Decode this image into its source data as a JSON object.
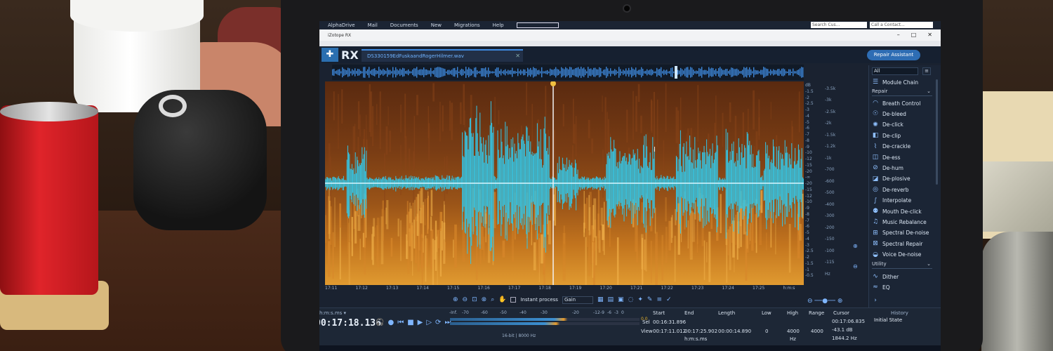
{
  "host_menu": [
    "AlphaDrive",
    "Mail",
    "Documents",
    "New",
    "Migrations",
    "Help"
  ],
  "host_search": "Search Cus...",
  "host_contact": "Call a Contact...",
  "window": {
    "title": "iZotope RX",
    "buttons": [
      "–",
      "□",
      "✕"
    ]
  },
  "app": {
    "logo": "RX",
    "file_tab": "DS330159EdFuskaandRogerHilmer.wav",
    "repair_assistant": "Repair Assistant"
  },
  "db_scale": [
    "dB",
    "-1.5",
    "-2",
    "-2.5",
    "-3",
    "-4",
    "-5",
    "-6",
    "-7",
    "-8",
    "-9",
    "-10",
    "-12",
    "-15",
    "-20",
    "-∞",
    "-20",
    "-15",
    "-12",
    "-10",
    "-9",
    "-8",
    "-7",
    "-6",
    "-5",
    "-4",
    "-3",
    "-2.5",
    "-2",
    "-1.5",
    "-1",
    "-0.5"
  ],
  "hz_scale": [
    "-3.5k",
    "-3k",
    "-2.5k",
    "-2k",
    "-1.5k",
    "-1.2k",
    "-1k",
    "-700",
    "-600",
    "-500",
    "-400",
    "-300",
    "-200",
    "-150",
    "-100",
    "-115",
    "Hz"
  ],
  "time_axis": [
    "17:11",
    "17:12",
    "17:13",
    "17:14",
    "17:15",
    "17:16",
    "17:17",
    "17:18",
    "17:19",
    "17:20",
    "17:21",
    "17:22",
    "17:23",
    "17:24",
    "17:25",
    "h:m:s"
  ],
  "toolbar": {
    "instant_process": "Instant process",
    "mode": "Gain"
  },
  "transport": {
    "format": "h:m:s.ms ▾",
    "timecode": "00:17:18.136"
  },
  "meter": {
    "labels": [
      "-Inf.",
      "-70",
      "-60",
      "-50",
      "-40",
      "-30",
      "-20",
      "-12",
      "-9",
      "-6",
      "-3",
      "0"
    ],
    "peak": "0.0",
    "bit_depth": "16-bit | 8000 Hz"
  },
  "selection": {
    "headers": [
      "Start",
      "End",
      "Length",
      "Low",
      "High",
      "Range",
      "Cursor"
    ],
    "sel_label": "Sel",
    "view_label": "View",
    "sel_start": "00:16:31.896",
    "view_start": "00:17:11.012",
    "view_end": "00:17:25.902",
    "view_length": "00:00:14.890",
    "low": "0",
    "high": "4000",
    "range": "4000",
    "units_time": "h:m:s.ms",
    "units_hz": "Hz",
    "cursor_time": "00:17:06.835",
    "cursor_db": "-43.1 dB",
    "cursor_hz": "1844.2 Hz"
  },
  "history": {
    "title": "History",
    "item": "Initial State"
  },
  "panel": {
    "filter": "All",
    "module_chain": "Module Chain",
    "repair_header": "Repair",
    "repair_items": [
      "Breath Control",
      "De-bleed",
      "De-click",
      "De-clip",
      "De-crackle",
      "De-ess",
      "De-hum",
      "De-plosive",
      "De-reverb",
      "Interpolate",
      "Mouth De-click",
      "Music Rebalance",
      "Spectral De-noise",
      "Spectral Repair",
      "Voice De-noise"
    ],
    "utility_header": "Utility",
    "utility_items": [
      "Dither",
      "EQ"
    ]
  }
}
